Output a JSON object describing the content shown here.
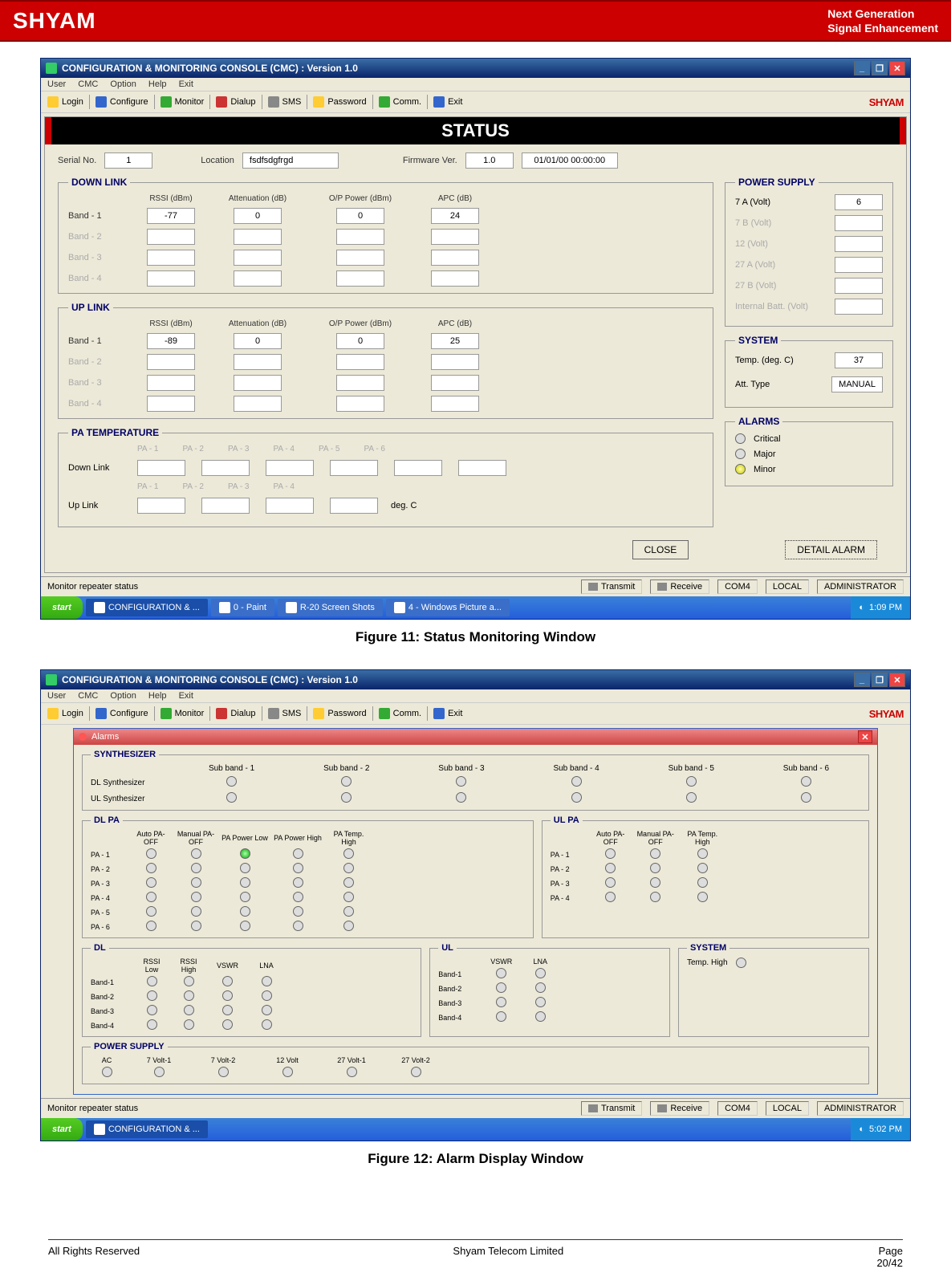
{
  "page_header": {
    "logo": "SHYAM",
    "line1": "Next Generation",
    "line2": "Signal Enhancement"
  },
  "app_title": "CONFIGURATION & MONITORING CONSOLE (CMC)  :  Version 1.0",
  "menubar": [
    "User",
    "CMC",
    "Option",
    "Help",
    "Exit"
  ],
  "toolbar": {
    "login": "Login",
    "configure": "Configure",
    "monitor": "Monitor",
    "dialup": "Dialup",
    "sms": "SMS",
    "password": "Password",
    "comm": "Comm.",
    "exit": "Exit",
    "brand": "SHYAM"
  },
  "status": {
    "header": "STATUS",
    "serial_lbl": "Serial No.",
    "serial_val": "1",
    "loc_lbl": "Location",
    "loc_val": "fsdfsdgfrgd",
    "fw_lbl": "Firmware Ver.",
    "fw_val": "1.0",
    "ts": "01/01/00 00:00:00",
    "downlink": {
      "legend": "DOWN LINK",
      "cols": {
        "rssi": "RSSI\n(dBm)",
        "att": "Attenuation\n(dB)",
        "op": "O/P Power\n(dBm)",
        "apc": "APC\n(dB)"
      },
      "bands": [
        {
          "label": "Band - 1",
          "active": true,
          "rssi": "-77",
          "att": "0",
          "op": "0",
          "apc": "24"
        },
        {
          "label": "Band - 2",
          "active": false
        },
        {
          "label": "Band - 3",
          "active": false
        },
        {
          "label": "Band - 4",
          "active": false
        }
      ]
    },
    "uplink": {
      "legend": "UP LINK",
      "cols": {
        "rssi": "RSSI\n(dBm)",
        "att": "Attenuation\n(dB)",
        "op": "O/P Power\n(dBm)",
        "apc": "APC\n(dB)"
      },
      "bands": [
        {
          "label": "Band - 1",
          "active": true,
          "rssi": "-89",
          "att": "0",
          "op": "0",
          "apc": "25"
        },
        {
          "label": "Band - 2",
          "active": false
        },
        {
          "label": "Band - 3",
          "active": false
        },
        {
          "label": "Band - 4",
          "active": false
        }
      ]
    },
    "power": {
      "legend": "POWER SUPPLY",
      "rows": [
        {
          "label": "7 A (Volt)",
          "dis": false,
          "val": "6"
        },
        {
          "label": "7 B (Volt)",
          "dis": true,
          "val": ""
        },
        {
          "label": "12 (Volt)",
          "dis": true,
          "val": ""
        },
        {
          "label": "27 A  (Volt)",
          "dis": true,
          "val": ""
        },
        {
          "label": "27 B  (Volt)",
          "dis": true,
          "val": ""
        },
        {
          "label": "Internal Batt. (Volt)",
          "dis": true,
          "val": ""
        }
      ]
    },
    "system": {
      "legend": "SYSTEM",
      "temp_lbl": "Temp. (deg. C)",
      "temp_val": "37",
      "att_lbl": "Att. Type",
      "att_val": "MANUAL"
    },
    "alarms": {
      "legend": "ALARMS",
      "items": [
        {
          "label": "Critical",
          "color": ""
        },
        {
          "label": "Major",
          "color": ""
        },
        {
          "label": "Minor",
          "color": "yellow"
        }
      ]
    },
    "patemp": {
      "legend": "PA TEMPERATURE",
      "downlink_lbl": "Down Link",
      "uplink_lbl": "Up Link",
      "unit": "deg. C",
      "dl_cols": [
        "PA - 1",
        "PA - 2",
        "PA - 3",
        "PA - 4",
        "PA - 5",
        "PA - 6"
      ],
      "ul_cols": [
        "PA - 1",
        "PA - 2",
        "PA - 3",
        "PA - 4"
      ]
    },
    "buttons": {
      "close": "CLOSE",
      "detail": "DETAIL ALARM"
    }
  },
  "statusbar": {
    "msg": "Monitor repeater status",
    "transmit": "Transmit",
    "receive": "Receive",
    "com": "COM4",
    "mode": "LOCAL",
    "user": "ADMINISTRATOR"
  },
  "taskbar": {
    "start": "start",
    "items": [
      {
        "label": "CONFIGURATION & ...",
        "active": true
      },
      {
        "label": "0 - Paint",
        "active": false
      },
      {
        "label": "R-20 Screen Shots",
        "active": false
      },
      {
        "label": "4 - Windows Picture a...",
        "active": false
      }
    ],
    "time": "1:09 PM"
  },
  "caption1": "Figure 11: Status Monitoring Window",
  "alarms_win": {
    "dlg_title": "Alarms",
    "syn": {
      "legend": "SYNTHESIZER",
      "cols": [
        "Sub band - 1",
        "Sub band - 2",
        "Sub band - 3",
        "Sub band - 4",
        "Sub band - 5",
        "Sub band - 6"
      ],
      "rows": [
        {
          "label": "DL Synthesizer"
        },
        {
          "label": "UL Synthesizer"
        }
      ]
    },
    "dlpa": {
      "legend": "DL PA",
      "cols": [
        "Auto PA-OFF",
        "Manual PA-OFF",
        "PA Power Low",
        "PA Power High",
        "PA Temp. High"
      ],
      "rows": [
        "PA - 1",
        "PA - 2",
        "PA - 3",
        "PA - 4",
        "PA - 5",
        "PA - 6"
      ]
    },
    "ulpa": {
      "legend": "UL PA",
      "cols": [
        "Auto PA-OFF",
        "Manual PA-OFF",
        "PA Temp. High"
      ],
      "rows": [
        "PA - 1",
        "PA - 2",
        "PA - 3",
        "PA - 4"
      ]
    },
    "dl": {
      "legend": "DL",
      "cols": [
        "RSSI Low",
        "RSSI High",
        "VSWR",
        "LNA"
      ],
      "rows": [
        "Band-1",
        "Band-2",
        "Band-3",
        "Band-4"
      ]
    },
    "ul": {
      "legend": "UL",
      "cols": [
        "VSWR",
        "LNA"
      ],
      "rows": [
        "Band-1",
        "Band-2",
        "Band-3",
        "Band-4"
      ]
    },
    "system2": {
      "legend": "SYSTEM",
      "temp_lbl": "Temp. High"
    },
    "ps2": {
      "legend": "POWER SUPPLY",
      "cols": [
        "AC",
        "7 Volt-1",
        "7 Volt-2",
        "12 Volt",
        "27 Volt-1",
        "27 Volt-2"
      ]
    },
    "taskbar2": {
      "items": [
        {
          "label": "CONFIGURATION & ..."
        }
      ],
      "time": "5:02 PM"
    }
  },
  "caption2": "Figure 12: Alarm Display Window",
  "footer": {
    "left": "All Rights Reserved",
    "center": "Shyam Telecom Limited",
    "right_lbl": "Page",
    "right_val": "20/42"
  }
}
